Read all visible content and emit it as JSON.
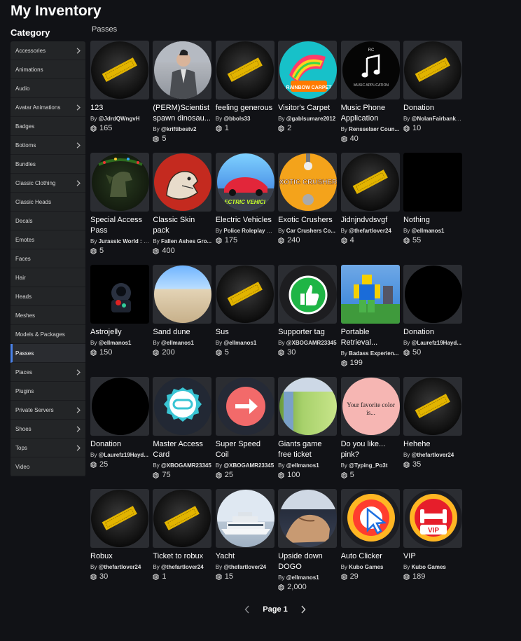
{
  "header": {
    "title": "My Inventory"
  },
  "sidebar": {
    "title": "Category",
    "active": "Passes",
    "items": [
      {
        "label": "Accessories",
        "chevron": true
      },
      {
        "label": "Animations",
        "chevron": false
      },
      {
        "label": "Audio",
        "chevron": false
      },
      {
        "label": "Avatar Animations",
        "chevron": true
      },
      {
        "label": "Badges",
        "chevron": false
      },
      {
        "label": "Bottoms",
        "chevron": true
      },
      {
        "label": "Bundles",
        "chevron": false
      },
      {
        "label": "Classic Clothing",
        "chevron": true
      },
      {
        "label": "Classic Heads",
        "chevron": false
      },
      {
        "label": "Decals",
        "chevron": false
      },
      {
        "label": "Emotes",
        "chevron": false
      },
      {
        "label": "Faces",
        "chevron": false
      },
      {
        "label": "Hair",
        "chevron": false
      },
      {
        "label": "Heads",
        "chevron": false
      },
      {
        "label": "Meshes",
        "chevron": false
      },
      {
        "label": "Models & Packages",
        "chevron": false
      },
      {
        "label": "Passes",
        "chevron": false
      },
      {
        "label": "Places",
        "chevron": true
      },
      {
        "label": "Plugins",
        "chevron": false
      },
      {
        "label": "Private Servers",
        "chevron": true
      },
      {
        "label": "Shoes",
        "chevron": true
      },
      {
        "label": "Tops",
        "chevron": true
      },
      {
        "label": "Video",
        "chevron": false
      }
    ]
  },
  "section": {
    "label": "Passes"
  },
  "by_prefix": "By",
  "items": [
    {
      "name": "123",
      "creator": "@JdrdQWngvH",
      "price": "165",
      "thumb": "ticket"
    },
    {
      "name": "(PERM)Scientist spawn dinosau...",
      "creator": "@kriftibestv2",
      "price": "5",
      "thumb": "person"
    },
    {
      "name": "feeling generous",
      "creator": "@bbols33",
      "price": "1",
      "thumb": "ticket"
    },
    {
      "name": "Visitor's Carpet",
      "creator": "@gablsumare2012",
      "price": "2",
      "thumb": "carpet",
      "thumb_text": "RAINBOW CARPET"
    },
    {
      "name": "Music Phone Application",
      "creator": "Rensselaer Coun...",
      "price": "40",
      "thumb": "music",
      "thumb_text": "MUSIC APPLICATION",
      "thumb_brand": "RC"
    },
    {
      "name": "Donation",
      "creator": "@NolanFairbanks...",
      "price": "10",
      "thumb": "ticket"
    },
    {
      "name": "Special Access Pass",
      "creator": "Jurassic World : R...",
      "price": "5",
      "thumb": "dino"
    },
    {
      "name": "Classic Skin pack",
      "creator": "Fallen Ashes Gro...",
      "price": "400",
      "thumb": "beast"
    },
    {
      "name": "Electric Vehicles",
      "creator": "Police Roleplay C...",
      "price": "175",
      "thumb": "car",
      "thumb_text": "ELECTRIC VEHICLES"
    },
    {
      "name": "Exotic Crushers",
      "creator": "Car Crushers Co...",
      "price": "240",
      "thumb": "exotic",
      "thumb_text": "EXOTIC CRUSHERS"
    },
    {
      "name": "Jidnjndvdsvgf",
      "creator": "@thefartlover24",
      "price": "4",
      "thumb": "ticket"
    },
    {
      "name": "Nothing",
      "creator": "@ellmanos1",
      "price": "55",
      "thumb": "black-square"
    },
    {
      "name": "Astrojelly",
      "creator": "@ellmanos1",
      "price": "150",
      "thumb": "astro"
    },
    {
      "name": "Sand dune",
      "creator": "@ellmanos1",
      "price": "200",
      "thumb": "dune"
    },
    {
      "name": "Sus",
      "creator": "@ellmanos1",
      "price": "5",
      "thumb": "ticket"
    },
    {
      "name": "Supporter tag",
      "creator": "@XBOGAMR23345",
      "price": "30",
      "thumb": "thumbsup"
    },
    {
      "name": "Portable Retrieval...",
      "creator": "Badass Experien...",
      "price": "199",
      "thumb": "noob"
    },
    {
      "name": "Donation",
      "creator": "@Laurefz19Hayd...",
      "price": "50",
      "thumb": "black-circle"
    },
    {
      "name": "Donation",
      "creator": "@Laurefz19Hayd...",
      "price": "25",
      "thumb": "black-circle"
    },
    {
      "name": "Master Access Card",
      "creator": "@XBOGAMR23345",
      "price": "75",
      "thumb": "infinity"
    },
    {
      "name": "Super Speed Coil",
      "creator": "@XBOGAMR23345",
      "price": "25",
      "thumb": "arrow"
    },
    {
      "name": "Giants game free ticket",
      "creator": "@ellmanos1",
      "price": "100",
      "thumb": "green"
    },
    {
      "name": "Do you like... pink?",
      "creator": "@Typing_Po3t",
      "price": "5",
      "thumb": "pink",
      "thumb_text": "Your favorite color is..."
    },
    {
      "name": "Hehehe",
      "creator": "@thefartlover24",
      "price": "35",
      "thumb": "ticket"
    },
    {
      "name": "Robux",
      "creator": "@thefartlover24",
      "price": "30",
      "thumb": "ticket"
    },
    {
      "name": "Ticket to robux",
      "creator": "@thefartlover24",
      "price": "1",
      "thumb": "ticket"
    },
    {
      "name": "Yacht",
      "creator": "@thefartlover24",
      "price": "15",
      "thumb": "yacht"
    },
    {
      "name": "Upside down DOGO",
      "creator": "@ellmanos1",
      "price": "2,000",
      "thumb": "dog"
    },
    {
      "name": "Auto Clicker",
      "creator": "Kubo Games",
      "price": "29",
      "thumb": "clicker"
    },
    {
      "name": "VIP",
      "creator": "Kubo Games",
      "price": "189",
      "thumb": "vip",
      "thumb_text": "VIP"
    }
  ],
  "pagination": {
    "label": "Page 1"
  },
  "colors": {
    "background": "#111216",
    "sidebar": "#232527",
    "active_accent": "#4a82e8",
    "ticket_gold": "#e2b400"
  }
}
